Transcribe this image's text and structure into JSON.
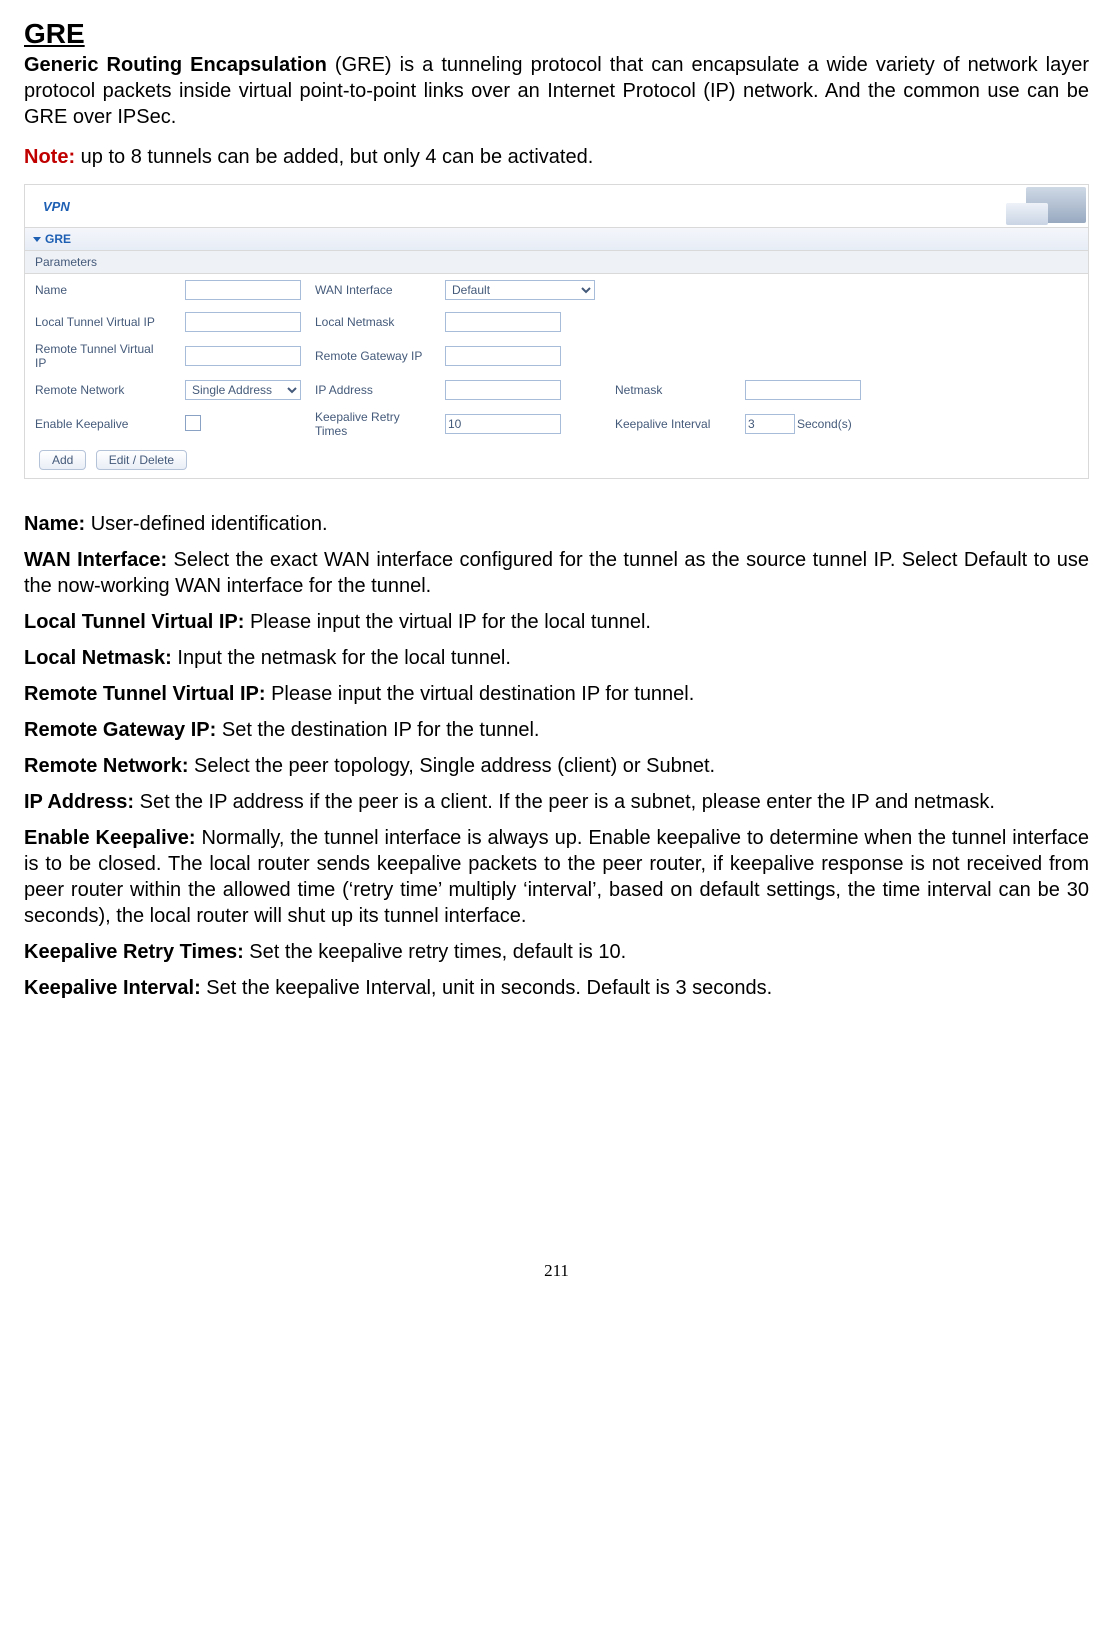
{
  "heading": "GRE",
  "intro_bold": "Generic Routing Encapsulation",
  "intro_rest": " (GRE) is a tunneling protocol that can encapsulate a wide variety of network layer protocol packets inside virtual point-to-point links over an Internet Protocol (IP) network. And the common use can be GRE over IPSec.",
  "note_label": "Note:",
  "note_text": " up to 8 tunnels can be added, but only 4 can be activated.",
  "panel": {
    "title": "VPN",
    "section": "GRE",
    "parameters_label": "Parameters",
    "rows": {
      "name": {
        "label": "Name",
        "value": "",
        "label2": "WAN Interface",
        "wan_options": [
          "Default"
        ],
        "wan_selected": "Default"
      },
      "localtun": {
        "label": "Local Tunnel Virtual IP",
        "value": "",
        "label2": "Local Netmask",
        "value2": ""
      },
      "remotetun": {
        "label": "Remote Tunnel Virtual IP",
        "value": "",
        "label2": "Remote Gateway IP",
        "value2": ""
      },
      "remotenet": {
        "label": "Remote Network",
        "select_options": [
          "Single Address"
        ],
        "select_value": "Single Address",
        "label2": "IP Address",
        "value2": "",
        "label3": "Netmask",
        "value3": ""
      },
      "keepalive": {
        "label": "Enable Keepalive",
        "checked": false,
        "label2": "Keepalive Retry Times",
        "value2": "10",
        "label3": "Keepalive Interval",
        "value3": "3",
        "suffix": "Second(s)"
      }
    },
    "buttons": {
      "add": "Add",
      "edit": "Edit / Delete"
    }
  },
  "descs": [
    {
      "label": "Name:",
      "text": " User-defined identification."
    },
    {
      "label": "WAN Interface:",
      "text": " Select the exact WAN interface configured for the tunnel as the source tunnel IP. Select Default to use the now-working WAN interface for the tunnel."
    },
    {
      "label": "Local Tunnel Virtual IP:",
      "text": " Please input the virtual IP for the local tunnel."
    },
    {
      "label": "Local Netmask:",
      "text": " Input the netmask for the local tunnel."
    },
    {
      "label": "Remote Tunnel Virtual IP:",
      "text": " Please input the virtual destination IP for tunnel."
    },
    {
      "label": "Remote Gateway IP:",
      "text": " Set the destination IP for the tunnel."
    },
    {
      "label": "Remote Network:",
      "text": " Select the peer topology, Single address (client) or Subnet."
    },
    {
      "label": "IP Address:",
      "text": " Set the IP address if the peer is a client. If the peer is a subnet, please enter the IP and netmask."
    },
    {
      "label": "Enable Keepalive:",
      "text": " Normally, the tunnel interface is always up. Enable keepalive to determine when the tunnel interface is to be closed. The local router sends keepalive packets to the peer router, if keepalive response is not received from peer router within the allowed time (‘retry time’ multiply ‘interval’, based on default settings, the time interval can be 30 seconds), the local router will shut up its tunnel interface."
    },
    {
      "label": "Keepalive Retry Times:",
      "text": " Set the keepalive retry times, default is 10."
    },
    {
      "label": "Keepalive Interval:",
      "text": " Set the keepalive Interval, unit in seconds. Default is 3 seconds."
    }
  ],
  "page_number": "211"
}
